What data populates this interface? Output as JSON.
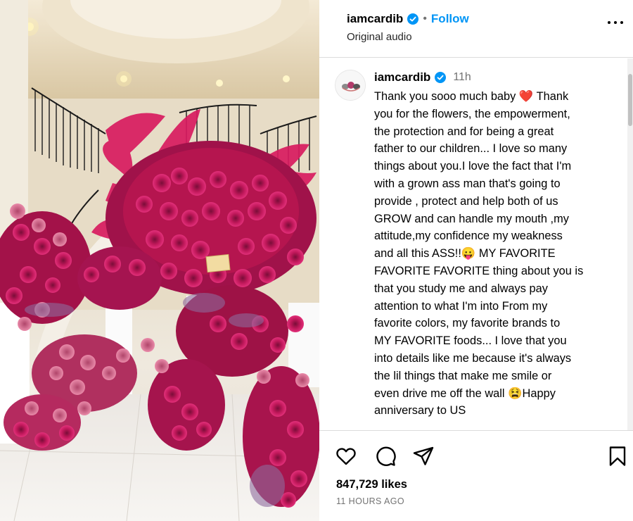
{
  "post": {
    "username": "iamcardib",
    "follow_label": "Follow",
    "separator": "•",
    "audio_label": "Original audio",
    "time": "11h",
    "caption": "Thank you sooo much baby ❤️ Thank\nyou for the flowers, the empowerment,\nthe protection and for being a great\nfather to our children... I love so many\nthings about you.I love the fact that I'm\nwith a grown ass man that's going to\nprovide , protect and help both of us\nGROW and can handle my mouth ,my\nattitude,my confidence my weakness\nand all this ASS!!😛 MY FAVORITE\nFAVORITE FAVORITE thing about you is\nthat you study me and always pay\nattention to what I'm into From my\nfavorite colors, my favorite brands to\nMY FAVORITE foods... I love that you\ninto details like me because it's always\nthe lil things that make me smile or\neven drive me off the wall 😫Happy\nanniversary to US",
    "likes_label": "847,729 likes",
    "posted_ago": "11 HOURS AGO"
  },
  "icons": {
    "verified": "verified-badge-icon",
    "more": "more-options-icon",
    "like": "heart-icon",
    "comment": "comment-icon",
    "share": "share-icon",
    "save": "bookmark-icon"
  },
  "colors": {
    "accent": "#0095f6",
    "muted": "#737373",
    "border": "#dbdbdb",
    "flowers": "#c2185b"
  }
}
